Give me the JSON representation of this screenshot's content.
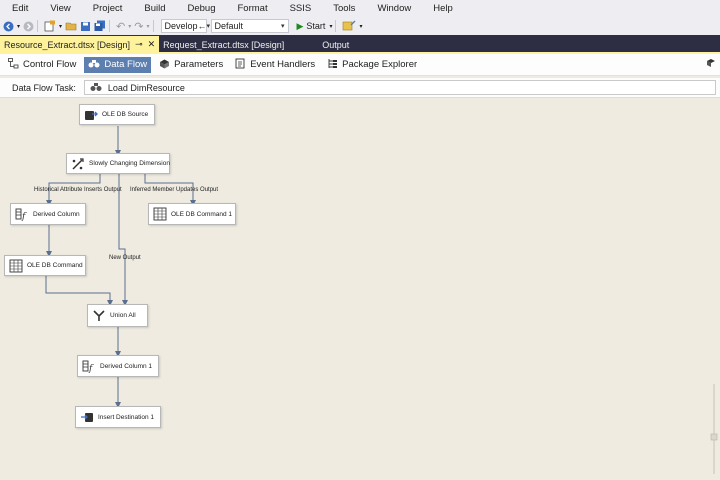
{
  "menu": [
    "Edit",
    "View",
    "Project",
    "Build",
    "Debug",
    "Format",
    "SSIS",
    "Tools",
    "Window",
    "Help"
  ],
  "toolbar": {
    "config": "Develop←",
    "platform": "Default",
    "start": "Start"
  },
  "tabs": [
    {
      "label": "Resource_Extract.dtsx [Design]",
      "active": true
    },
    {
      "label": "Request_Extract.dtsx [Design]",
      "active": false
    },
    {
      "label": "Output",
      "active": false
    }
  ],
  "designer_tabs": [
    {
      "label": "Control Flow",
      "icon": "control-flow-icon",
      "active": false
    },
    {
      "label": "Data Flow",
      "icon": "data-flow-icon",
      "active": true
    },
    {
      "label": "Parameters",
      "icon": "parameters-icon",
      "active": false
    },
    {
      "label": "Event Handlers",
      "icon": "event-handlers-icon",
      "active": false
    },
    {
      "label": "Package Explorer",
      "icon": "package-explorer-icon",
      "active": false
    }
  ],
  "task": {
    "label": "Data Flow Task:",
    "value": "Load DimResource"
  },
  "nodes": [
    {
      "name": "node-ole-db-source",
      "label": "OLE DB Source",
      "icon": "ole-db-source-icon"
    },
    {
      "name": "node-slowly-changing-dimension",
      "label": "Slowly Changing Dimension",
      "icon": "scd-icon"
    },
    {
      "name": "node-derived-column",
      "label": "Derived Column",
      "icon": "derived-column-icon"
    },
    {
      "name": "node-ole-db-command-1",
      "label": "OLE DB Command 1",
      "icon": "ole-db-command-icon"
    },
    {
      "name": "node-ole-db-command",
      "label": "OLE DB Command",
      "icon": "ole-db-command-icon"
    },
    {
      "name": "node-union-all",
      "label": "Union All",
      "icon": "union-all-icon"
    },
    {
      "name": "node-derived-column-1",
      "label": "Derived Column 1",
      "icon": "derived-column-icon"
    },
    {
      "name": "node-insert-destination-1",
      "label": "Insert Destination 1",
      "icon": "destination-icon"
    }
  ],
  "paths": {
    "historical": "Historical Attribute Inserts Output",
    "inferred": "Inferred Member Updates Output",
    "new": "New Output"
  }
}
